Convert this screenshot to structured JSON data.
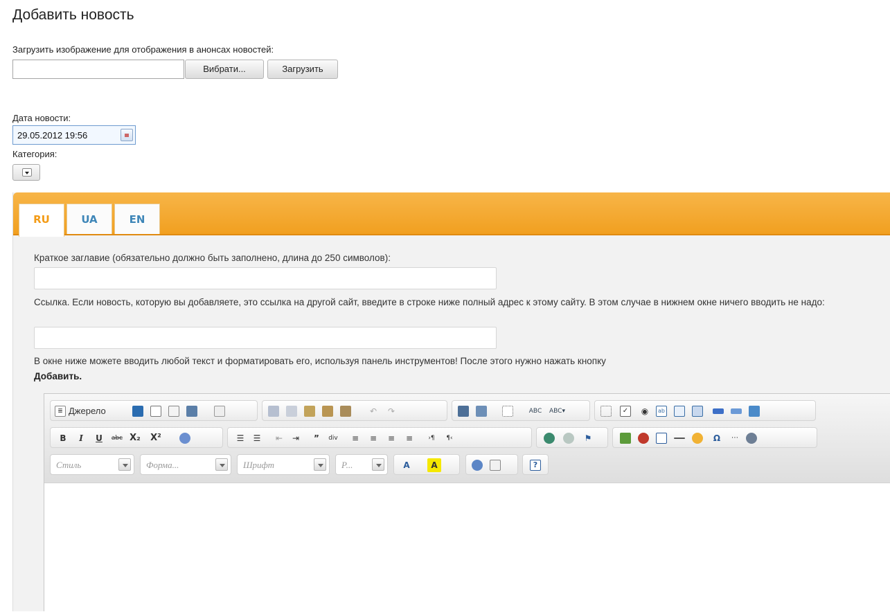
{
  "page": {
    "title": "Добавить новость",
    "upload_label": "Загрузить изображение для отображения в анонсах новостей:",
    "browse_button": "Вибрати...",
    "upload_button": "Загрузить",
    "date_label": "Дата новости:",
    "date_value": "29.05.2012 19:56",
    "category_label": "Категория:"
  },
  "tabs": [
    {
      "label": "RU",
      "active": true
    },
    {
      "label": "UA",
      "active": false
    },
    {
      "label": "EN",
      "active": false
    }
  ],
  "form": {
    "short_title_label": "Краткое заглавие (обязательно должно быть заполнено, длина до 250 символов):",
    "link_label": "Ссылка. Если новость, которую вы добавляете, это ссылка на другой сайт, введите в строке ниже полный адрес к этому сайту. В этом случае в нижнем окне ничего вводить не надо:",
    "editor_hint": "В окне ниже можете вводить любой текст и форматировать его, используя панель инструментов! После этого нужно нажать кнопку",
    "editor_hint_bold": "Добавить."
  },
  "editor": {
    "source_label": "Джерело",
    "format_labels": {
      "bold": "B",
      "italic": "I",
      "underline": "U",
      "strike": "abc",
      "subscript": "X₂",
      "superscript": "X²",
      "omega": "Ω"
    },
    "combos": [
      {
        "name": "style",
        "placeholder": "Стиль"
      },
      {
        "name": "format",
        "placeholder": "Форма..."
      },
      {
        "name": "font",
        "placeholder": "Шрифт"
      },
      {
        "name": "size",
        "placeholder": "Р..."
      }
    ],
    "colors": {
      "accent": "#f39b16",
      "tab_inactive": "#3e86b8",
      "bar": "#f4a92e"
    }
  }
}
